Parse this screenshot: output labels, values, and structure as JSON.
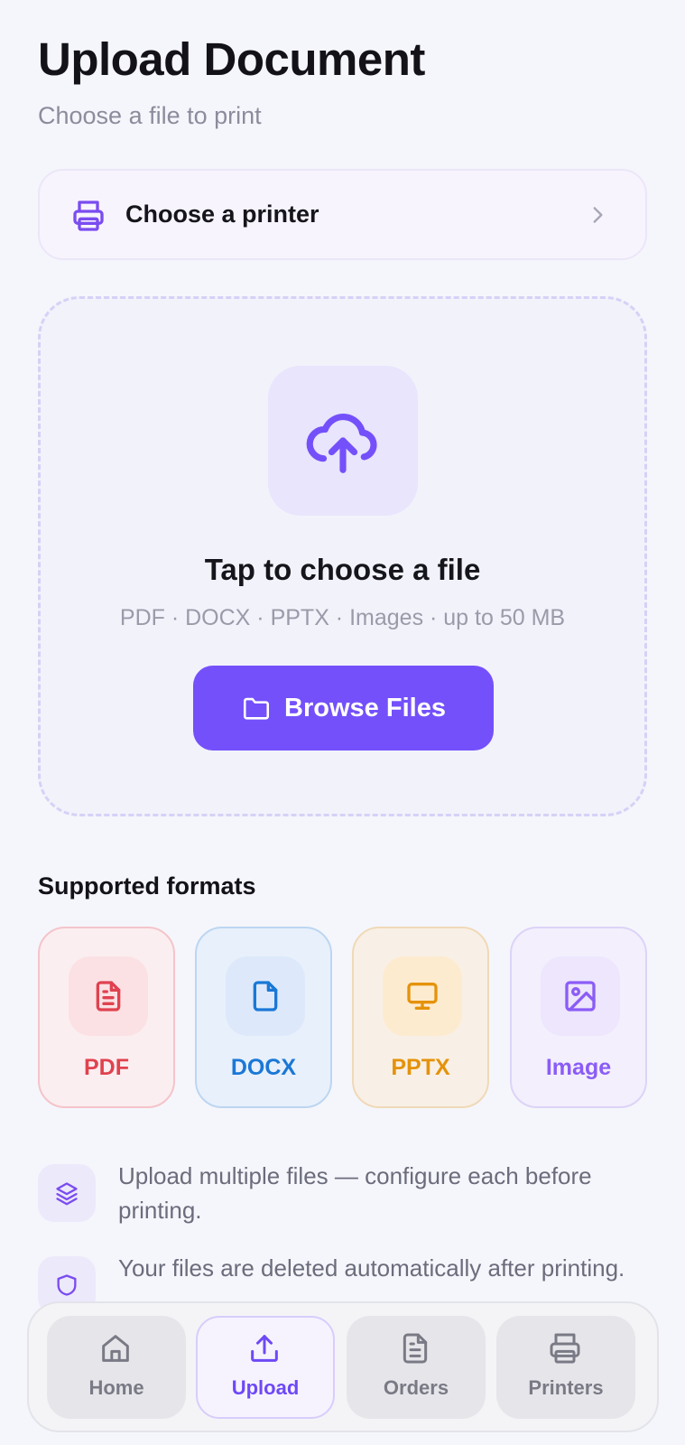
{
  "header": {
    "title": "Upload Document",
    "subtitle": "Choose a file to print"
  },
  "printer_selector": {
    "label": "Choose a printer",
    "icon": "printer-icon",
    "chevron": "chevron-right-icon"
  },
  "dropzone": {
    "icon": "cloud-upload-icon",
    "title": "Tap to choose a file",
    "hint": "PDF · DOCX · PPTX · Images · up to 50 MB",
    "button_label": "Browse Files",
    "button_icon": "folder-icon"
  },
  "formats": {
    "title": "Supported formats",
    "items": [
      {
        "label": "PDF",
        "icon": "pdf-file-icon",
        "color": "#e0424f"
      },
      {
        "label": "DOCX",
        "icon": "doc-file-icon",
        "color": "#1a78d6"
      },
      {
        "label": "PPTX",
        "icon": "presentation-icon",
        "color": "#e5920a"
      },
      {
        "label": "Image",
        "icon": "image-icon",
        "color": "#8b5cf6"
      }
    ]
  },
  "info": [
    {
      "icon": "layers-icon",
      "text": "Upload multiple files — configure each before printing."
    },
    {
      "icon": "shield-icon",
      "text": "Your files are deleted automatically after printing."
    }
  ],
  "nav": {
    "items": [
      {
        "label": "Home",
        "icon": "home-icon",
        "active": false
      },
      {
        "label": "Upload",
        "icon": "upload-icon",
        "active": true
      },
      {
        "label": "Orders",
        "icon": "orders-icon",
        "active": false
      },
      {
        "label": "Printers",
        "icon": "printer-icon",
        "active": false
      }
    ]
  },
  "colors": {
    "accent": "#7450fb",
    "background": "#f5f6fb"
  }
}
